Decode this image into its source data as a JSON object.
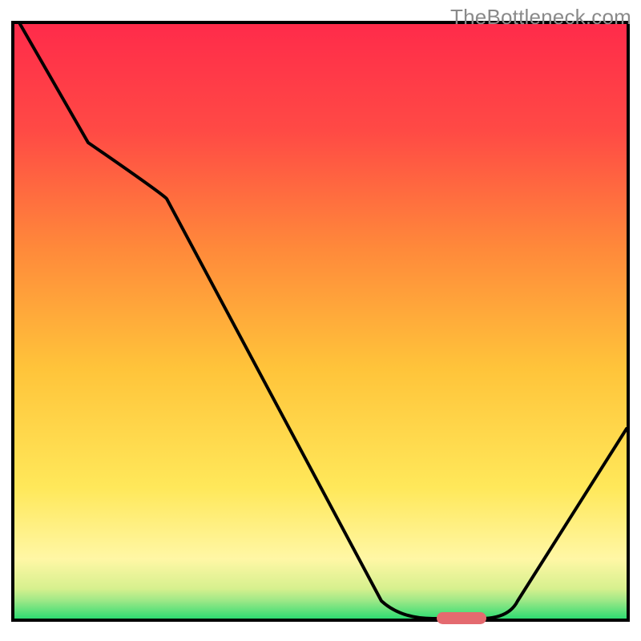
{
  "watermark": "TheBottleneck.com",
  "chart_data": {
    "type": "line",
    "title": "",
    "xlabel": "",
    "ylabel": "",
    "xlim": [
      0,
      100
    ],
    "ylim": [
      0,
      100
    ],
    "x": [
      1,
      12,
      25,
      60,
      68,
      76,
      82,
      100
    ],
    "y": [
      100,
      80,
      72,
      3,
      0,
      0,
      3,
      32
    ],
    "marker": {
      "x_start": 69,
      "x_end": 77,
      "y": 0
    },
    "colors": {
      "gradient_top": "#ff2b4a",
      "gradient_mid_high": "#ff7a2f",
      "gradient_mid": "#ffd43a",
      "gradient_low": "#fff79c",
      "gradient_ground": "#38e07a",
      "line": "#000000",
      "marker": "#e46a6f"
    }
  }
}
